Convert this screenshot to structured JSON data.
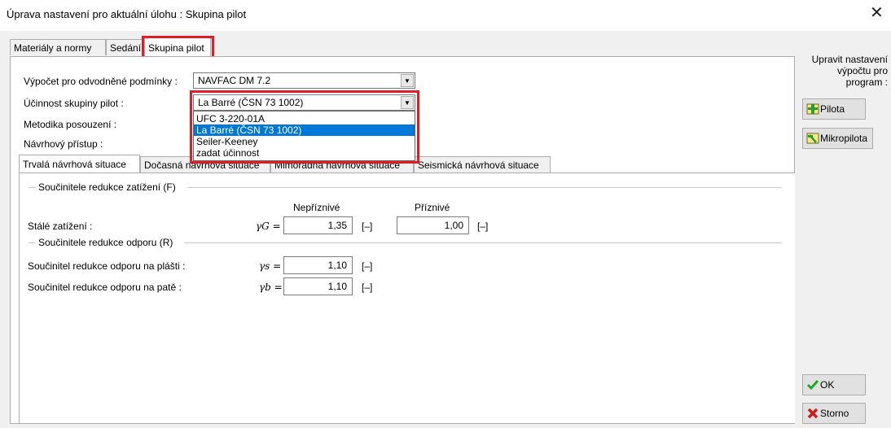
{
  "window": {
    "title": "Úprava nastavení pro aktuální úlohu : Skupina pilot",
    "close_glyph": "✕"
  },
  "tabs": [
    {
      "label": "Materiály a normy"
    },
    {
      "label": "Sedání"
    },
    {
      "label": "Skupina pilot"
    }
  ],
  "form": {
    "calc_label": "Výpočet pro odvodněné podmínky :",
    "calc_value": "NAVFAC DM 7.2",
    "efficiency_label": "Účinnost skupiny pilot :",
    "efficiency_value": "La Barré (ČSN 73 1002)",
    "method_label": "Metodika posouzení :",
    "approach_label": "Návrhový přístup :"
  },
  "dropdown": {
    "options": [
      {
        "label": "UFC 3-220-01A"
      },
      {
        "label": "La Barré (ČSN 73 1002)"
      },
      {
        "label": "Seiler-Keeney"
      },
      {
        "label": "zadat účinnost"
      }
    ],
    "selected_index": 1
  },
  "situation_tabs": [
    {
      "label": "Trvalá návrhová situace"
    },
    {
      "label": "Dočasná návrhová situace"
    },
    {
      "label": "Mimořádná návrhová situace"
    },
    {
      "label": "Seismická návrhová situace"
    }
  ],
  "load_group": {
    "title": "Součinitele redukce zatížení (F)",
    "col_unfavourable": "Nepříznivé",
    "col_favourable": "Příznivé",
    "row_label": "Stálé zatížení :",
    "symbol": "γG =",
    "unfavourable_value": "1,35",
    "favourable_value": "1,00",
    "unit": "[–]"
  },
  "resistance_group": {
    "title": "Součinitele redukce odporu (R)",
    "rows": [
      {
        "label": "Součinitel redukce odporu na plášti :",
        "symbol": "γs =",
        "value": "1,10",
        "unit": "[–]"
      },
      {
        "label": "Součinitel redukce odporu na patě :",
        "symbol": "γb =",
        "value": "1,10",
        "unit": "[–]"
      }
    ]
  },
  "right_panel": {
    "caption": "Upravit nastavení výpočtu pro program :",
    "pilota_label": "Pilota",
    "mikropilota_label": "Mikropilota",
    "ok_label": "OK",
    "storno_label": "Storno"
  },
  "colors": {
    "highlight_red": "#e01c24",
    "selection_blue": "#0078d7",
    "ok_green": "#22a822",
    "cancel_red": "#d11a1a"
  }
}
